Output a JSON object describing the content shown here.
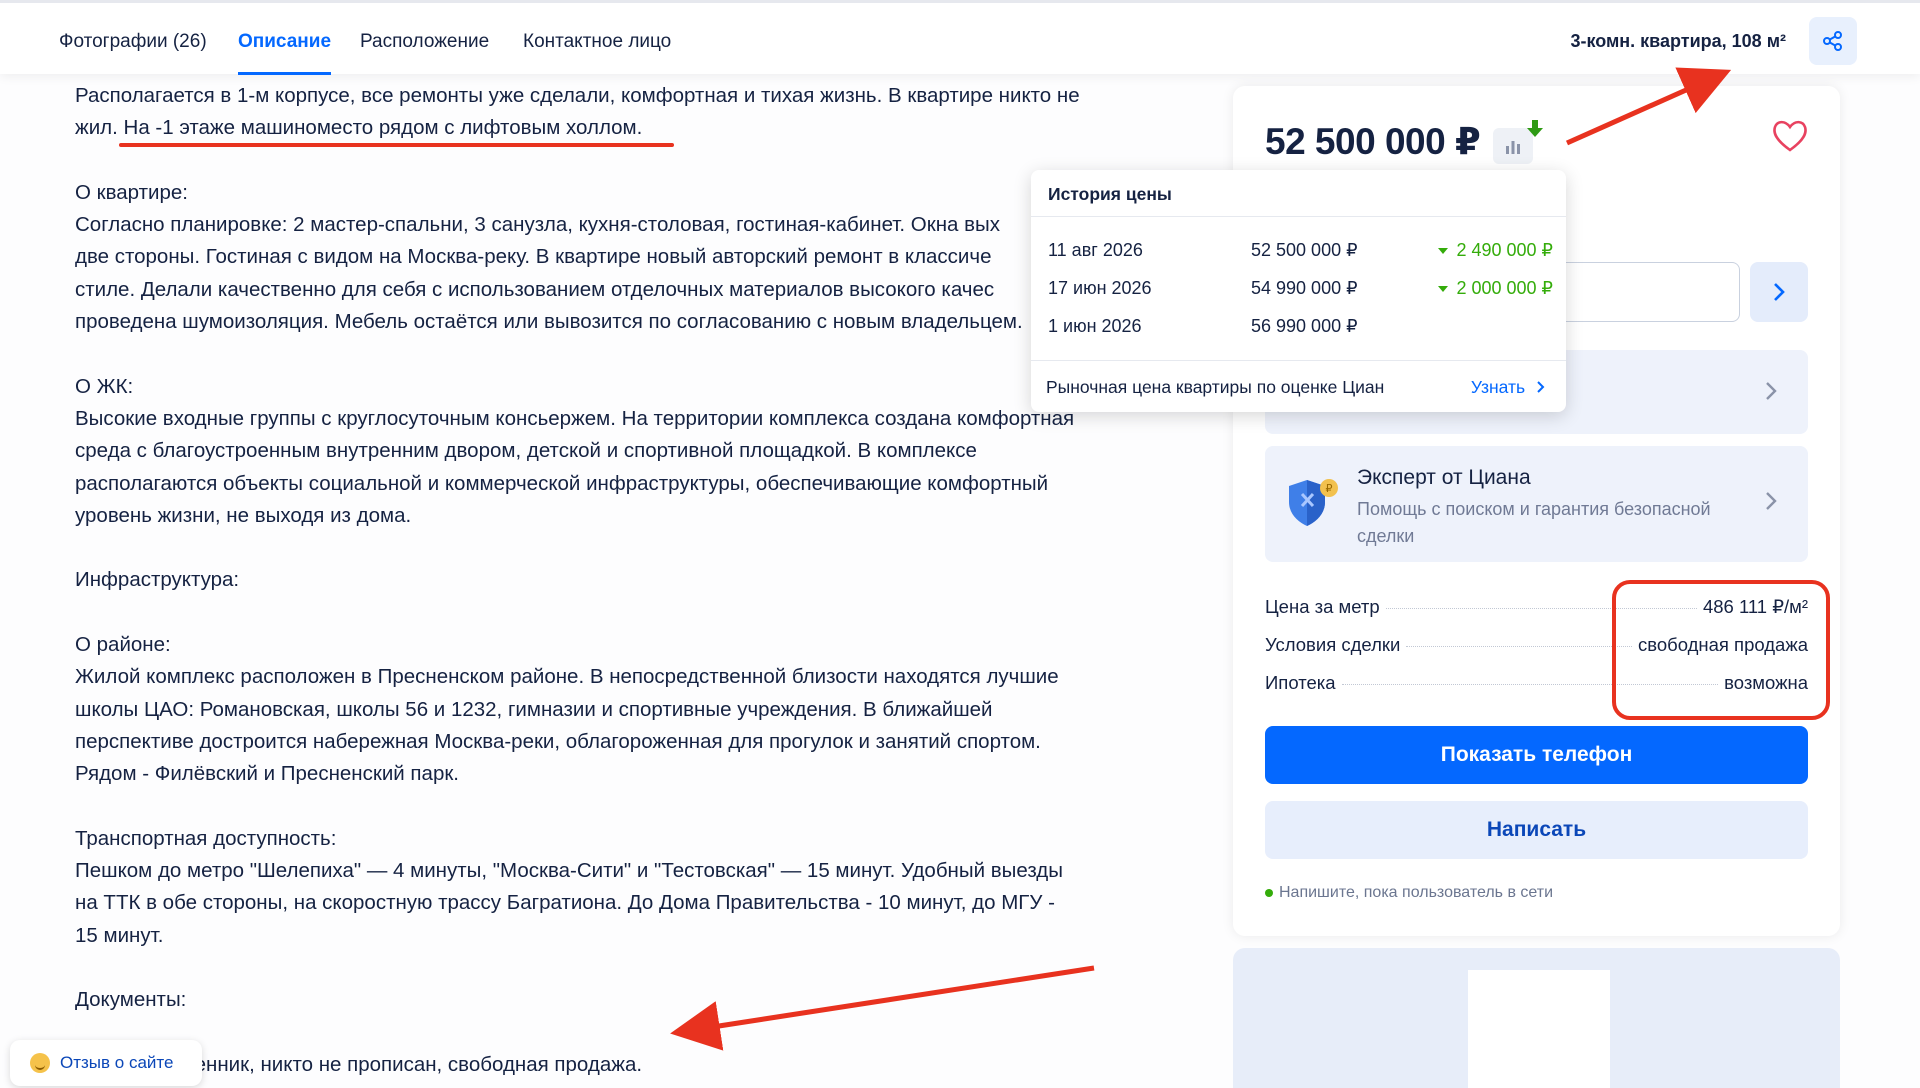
{
  "nav": {
    "tabs": [
      {
        "label": "Фотографии (26)",
        "active": false
      },
      {
        "label": "Описание",
        "active": true
      },
      {
        "label": "Расположение",
        "active": false
      },
      {
        "label": "Контактное лицо",
        "active": false
      }
    ],
    "flat_title": "3-комн. квартира, 108 м²",
    "share_icon": "share-icon"
  },
  "description": {
    "lines": [
      "Располагается в 1-м корпусе, все ремонты уже сделали, комфортная и тихая жизнь. В квартире никто не",
      "жил. На -1 этаже машиноместо рядом с лифтовым холлом.",
      "",
      "О квартире:",
      "Согласно планировке: 2 мастер-спальни, 3 санузла, кухня-столовая, гостиная-кабинет. Окна вых",
      "две стороны. Гостиная с видом на Москва-реку. В квартире новый авторский ремонт в классиче",
      "стиле. Делали качественно для себя с использованием отделочных материалов высокого качес",
      "проведена шумоизоляция. Мебель остаётся или вывозится по согласованию с новым владельцем.",
      "",
      "О ЖК:",
      "Высокие входные группы с круглосуточным консьержем. На территории комплекса создана комфортная",
      "среда с благоустроенным внутренним двором, детской и спортивной площадкой. В комплексе",
      "располагаются объекты социальной и коммерческой инфраструктуры, обеспечивающие комфортный",
      "уровень жизни, не выходя из дома.",
      "",
      "Инфраструктура:",
      "",
      "О районе:",
      "Жилой комплекс расположен в Пресненском районе. В непосредственной близости находятся лучшие",
      "школы ЦАО: Романовская, школы 56 и 1232, гимназии и спортивные учреждения. В ближайшей",
      "перспективе достроится набережная Москва-реки, облагороженная для прогулок и занятий спортом.",
      "Рядом - Филёвский и Пресненский парк.",
      "",
      "Транспортная доступность:",
      "Пешком до метро \"Шелепиха\" — 4 минуты, \"Москва-Сити\" и \"Тестовская\" — 15 минут. Удобный выезды",
      "на ТТК в обе стороны, на скоростную трассу Багратиона. До Дома Правительства - 10 минут, до МГУ -",
      "15 минут.",
      "",
      "Документы:",
      "",
      "Один собственник, никто не прописан, свободная продажа."
    ]
  },
  "offer": {
    "price": "52 500 000 ₽",
    "price_history": {
      "title": "История цены",
      "rows": [
        {
          "date": "11 авг 2026",
          "price": "52 500 000 ₽",
          "change": "2 490 000 ₽"
        },
        {
          "date": "17 июн 2026",
          "price": "54 990 000 ₽",
          "change": "2 000 000 ₽"
        },
        {
          "date": "1 июн 2026",
          "price": "56 990 000 ₽",
          "change": ""
        }
      ],
      "market_text": "Рыночная цена квартиры по оценке Циан",
      "learn_label": "Узнать"
    },
    "expert": {
      "title": "Эксперт от Циана",
      "subtitle": "Помощь с поиском и гарантия безопасной сделки"
    },
    "facts": [
      {
        "label": "Цена за метр",
        "value": "486 111 ₽/м²"
      },
      {
        "label": "Условия сделки",
        "value": "свободная продажа"
      },
      {
        "label": "Ипотека",
        "value": "возможна"
      }
    ],
    "show_phone_label": "Показать телефон",
    "write_label": "Написать",
    "online_note": "Напишите, пока пользователь в сети"
  },
  "feedback_label": "Отзыв о сайте",
  "colors": {
    "accent": "#0468ff",
    "annotation": "#e8321f",
    "positive": "#34ac0a"
  }
}
